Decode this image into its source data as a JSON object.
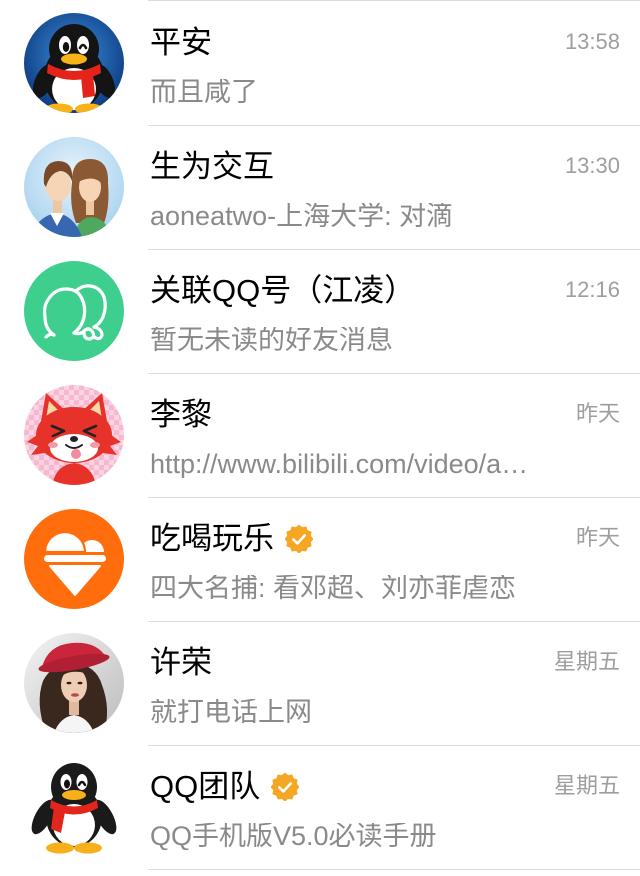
{
  "conversations": [
    {
      "name": "平安",
      "time": "13:58",
      "preview": "而且咸了",
      "verified": false,
      "avatar_icon": "qq-penguin-icon"
    },
    {
      "name": "生为交互",
      "time": "13:30",
      "preview": "aoneatwo-上海大学: 对滴",
      "verified": false,
      "avatar_icon": "couple-illustration-icon"
    },
    {
      "name": "关联QQ号（江凌）",
      "time": "12:16",
      "preview": "暂无未读的好友消息",
      "verified": false,
      "avatar_icon": "linked-accounts-icon"
    },
    {
      "name": "李黎",
      "time": "昨天",
      "preview": "http://www.bilibili.com/video/a…",
      "verified": false,
      "avatar_icon": "red-fox-icon"
    },
    {
      "name": "吃喝玩乐",
      "time": "昨天",
      "preview": "四大名捕: 看邓超、刘亦菲虐恋",
      "verified": true,
      "avatar_icon": "ice-cream-icon"
    },
    {
      "name": "许荣",
      "time": "星期五",
      "preview": "就打电话上网",
      "verified": false,
      "avatar_icon": "woman-red-hat-photo-icon"
    },
    {
      "name": "QQ团队",
      "time": "星期五",
      "preview": "QQ手机版V5.0必读手册",
      "verified": true,
      "avatar_icon": "qq-penguin-icon"
    }
  ],
  "colors": {
    "name": "#000000",
    "time": "#9e9e9e",
    "preview": "#8a8a8a",
    "separator": "#dcdcdc",
    "verified_badge": "#f5a623",
    "linked_accounts_bg": "#3ecf8e",
    "ice_cream_bg": "#ff6d0c"
  }
}
